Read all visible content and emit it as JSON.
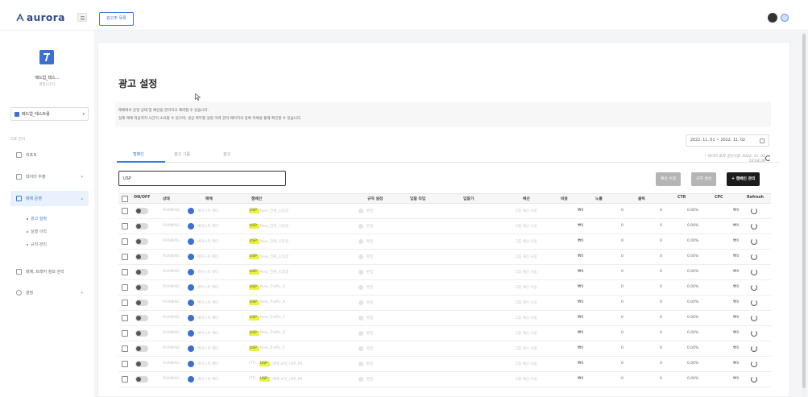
{
  "brand": {
    "name": "aurora"
  },
  "header": {
    "report_button": "광고주 목록"
  },
  "sidebar": {
    "account_name": "메드업_테스...",
    "account_sub": "계정(117)",
    "account_select": "메드업_테스트용",
    "section_label": "지표 관리",
    "items": [
      {
        "label": "리포트"
      },
      {
        "label": "데이터 추출"
      },
      {
        "label": "매체 운영"
      },
      {
        "label": "매체, 트래커 정보 관리"
      },
      {
        "label": "설정"
      }
    ],
    "sub_items": [
      {
        "label": "광고 설정"
      },
      {
        "label": "실행 이력"
      },
      {
        "label": "규칙 관리"
      }
    ]
  },
  "page": {
    "title": "광고 설정",
    "info_line1": "매체에서 운영 상태 및 예산을 관리하고 예약할 수 있습니다.",
    "info_line2": "실제 매체 적용까지 시간이 소요될 수 있으며, 성공 여부를 설정 이력 관리 페이지의 등록 목록을 통해 확인할 수 있습니다.",
    "date_range": "2022. 11. 01 ~ 2022. 11. 02",
    "tabs": [
      "캠페인",
      "광고 그룹",
      "광고"
    ],
    "data_note_line1": "* 데이터 조회 갱신시점: 2022. 11. 02",
    "data_note_line2": "10:04:38",
    "search_value": "USP",
    "buttons": {
      "budget": "예산 수정",
      "rule": "규칙 생성",
      "bulk": "+ 캠페인 관리"
    }
  },
  "table": {
    "headers": [
      "ON/OFF",
      "상태",
      "매체",
      "캠페인",
      "규칙 설정",
      "입찰 타입",
      "입찰가",
      "예산",
      "비용",
      "노출",
      "클릭",
      "CTR",
      "CPC",
      "Refresh"
    ],
    "rows": [
      {
        "status": "RUNNING",
        "media": "페이스북 메타",
        "campaign_hl": "USP",
        "campaign_rest": "New_전환_시장생",
        "rule": "편집",
        "budget": "그룹 예산 사용",
        "cost": "₩0",
        "imp": "0",
        "click": "0",
        "ctr": "0.00%",
        "cpc": "₩0"
      },
      {
        "status": "RUNNING",
        "media": "페이스북 메타",
        "campaign_hl": "USP",
        "campaign_rest": "New_전환_시장생",
        "rule": "편집",
        "budget": "그룹 예산 사용",
        "cost": "₩0",
        "imp": "0",
        "click": "0",
        "ctr": "0.00%",
        "cpc": "₩0"
      },
      {
        "status": "RUNNING",
        "media": "페이스북 메타",
        "campaign_hl": "USP",
        "campaign_rest": "New_전환_오후생",
        "rule": "편집",
        "budget": "그룹 예산 사용",
        "cost": "₩0",
        "imp": "0",
        "click": "0",
        "ctr": "0.00%",
        "cpc": "₩0"
      },
      {
        "status": "RUNNING",
        "media": "페이스북 메타",
        "campaign_hl": "USP",
        "campaign_rest": "New_전환_오후생",
        "rule": "편집",
        "budget": "그룹 예산 사용",
        "cost": "₩0",
        "imp": "0",
        "click": "0",
        "ctr": "0.00%",
        "cpc": "₩0"
      },
      {
        "status": "RUNNING",
        "media": "페이스북 메타",
        "campaign_hl": "USP",
        "campaign_rest": "New_전환_오후생",
        "rule": "편집",
        "budget": "그룹 예산 사용",
        "cost": "₩0",
        "imp": "0",
        "click": "0",
        "ctr": "0.00%",
        "cpc": "₩0"
      },
      {
        "status": "RUNNING",
        "media": "페이스북 메타",
        "campaign_hl": "USP",
        "campaign_rest": "New_Traffic_A",
        "rule": "편집",
        "budget": "그룹 예산 사용",
        "cost": "₩0",
        "imp": "0",
        "click": "0",
        "ctr": "0.00%",
        "cpc": "₩0"
      },
      {
        "status": "RUNNING",
        "media": "페이스북 메타",
        "campaign_hl": "USP",
        "campaign_rest": "New_Traffic_B",
        "rule": "편집",
        "budget": "그룹 예산 사용",
        "cost": "₩0",
        "imp": "0",
        "click": "0",
        "ctr": "0.00%",
        "cpc": "₩0"
      },
      {
        "status": "RUNNING",
        "media": "페이스북 메타",
        "campaign_hl": "USP",
        "campaign_rest": "New_Traffic_C",
        "rule": "편집",
        "budget": "그룹 예산 사용",
        "cost": "₩0",
        "imp": "0",
        "click": "0",
        "ctr": "0.00%",
        "cpc": "₩0"
      },
      {
        "status": "RUNNING",
        "media": "페이스북 메타",
        "campaign_hl": "USP",
        "campaign_rest": "New_Traffic_D",
        "rule": "편집",
        "budget": "그룹 예산 사용",
        "cost": "₩0",
        "imp": "0",
        "click": "0",
        "ctr": "0.00%",
        "cpc": "₩0"
      },
      {
        "status": "RUNNING",
        "media": "페이스북 메타",
        "campaign_hl": "USP",
        "campaign_rest": "New_Traffic_E",
        "rule": "편집",
        "budget": "그룹 예산 사용",
        "cost": "₩0",
        "imp": "0",
        "click": "0",
        "ctr": "0.00%",
        "cpc": "₩0"
      },
      {
        "status": "RUNNING",
        "media": "페이스북 메타",
        "campaign_pre": "(TF)",
        "campaign_hl": "USP",
        "campaign_rest": "_매체 요약_USP_KR",
        "rule": "편집",
        "budget": "그룹 예산 사용",
        "cost": "₩0",
        "imp": "0",
        "click": "0",
        "ctr": "0.00%",
        "cpc": "₩0"
      },
      {
        "status": "RUNNING",
        "media": "페이스북 메타",
        "campaign_pre": "(TF)",
        "campaign_hl": "USP",
        "campaign_rest": "_매체 요약_USP_KR",
        "rule": "편집",
        "budget": "그룹 예산 사용",
        "cost": "₩0",
        "imp": "0",
        "click": "0",
        "ctr": "0.00%",
        "cpc": "₩0"
      }
    ]
  },
  "colors": {
    "accent": "#3a7bd5",
    "highlight": "#e9f53a",
    "dark_button": "#1c1c1c"
  }
}
